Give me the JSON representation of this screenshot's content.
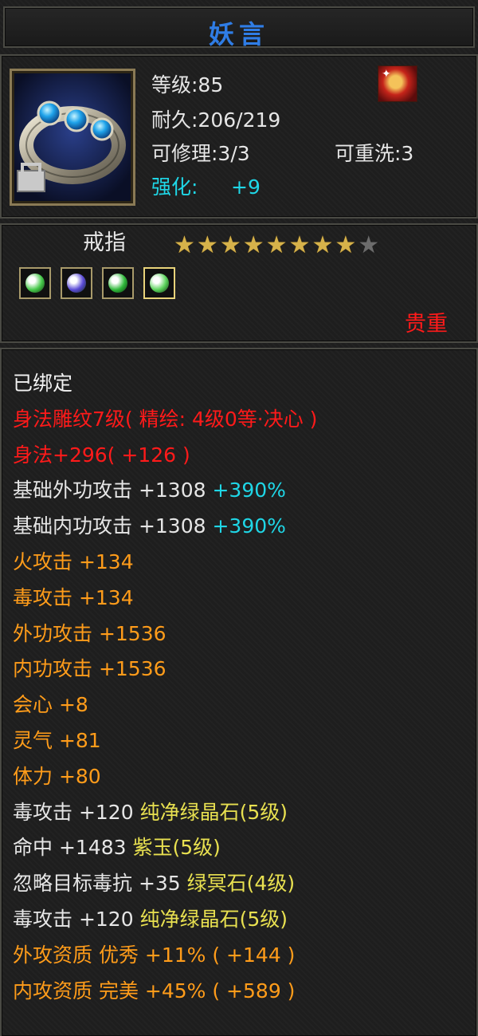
{
  "item": {
    "name": "妖言",
    "level": "等级:85",
    "durability": "耐久:206/219",
    "repair": "可修理:3/3",
    "rewash": "可重洗:3",
    "enhance_label": "强化:",
    "enhance_value": "+9",
    "type": "戒指",
    "rarity": "贵重",
    "stars_filled": 8,
    "stars_total": 9
  },
  "gems": [
    {
      "icon": "green-gem-icon",
      "color": "#46c84a"
    },
    {
      "icon": "purple-gem-icon",
      "color": "#5a4ad6"
    },
    {
      "icon": "green-crystal-icon",
      "color": "#2fb83a"
    },
    {
      "icon": "green-gem-icon",
      "color": "#5ad25a"
    }
  ],
  "stats": [
    {
      "parts": [
        {
          "t": "已绑定",
          "c": "white"
        }
      ]
    },
    {
      "parts": [
        {
          "t": "身法雕纹7级( 精绘: 4级0等·决心 )",
          "c": "red"
        }
      ]
    },
    {
      "parts": [
        {
          "t": "身法+296( +126 )",
          "c": "red"
        }
      ]
    },
    {
      "parts": [
        {
          "t": "基础外功攻击 +1308 ",
          "c": "gray"
        },
        {
          "t": "+390%",
          "c": "cyan"
        }
      ]
    },
    {
      "parts": [
        {
          "t": "基础内功攻击 +1308 ",
          "c": "gray"
        },
        {
          "t": "+390%",
          "c": "cyan"
        }
      ]
    },
    {
      "parts": [
        {
          "t": "火攻击 +134",
          "c": "orange"
        }
      ]
    },
    {
      "parts": [
        {
          "t": "毒攻击 +134",
          "c": "orange"
        }
      ]
    },
    {
      "parts": [
        {
          "t": "外功攻击 +1536",
          "c": "orange"
        }
      ]
    },
    {
      "parts": [
        {
          "t": "内功攻击 +1536",
          "c": "orange"
        }
      ]
    },
    {
      "parts": [
        {
          "t": "会心 +8",
          "c": "orange"
        }
      ]
    },
    {
      "parts": [
        {
          "t": "灵气 +81",
          "c": "orange"
        }
      ]
    },
    {
      "parts": [
        {
          "t": "体力 +80",
          "c": "orange"
        }
      ]
    },
    {
      "parts": [
        {
          "t": "毒攻击 +120 ",
          "c": "gray"
        },
        {
          "t": "纯净绿晶石(5级)",
          "c": "yellow"
        }
      ]
    },
    {
      "parts": [
        {
          "t": "命中 +1483 ",
          "c": "gray"
        },
        {
          "t": "紫玉(5级)",
          "c": "yellow"
        }
      ]
    },
    {
      "parts": [
        {
          "t": "忽略目标毒抗 +35 ",
          "c": "gray"
        },
        {
          "t": "绿冥石(4级)",
          "c": "yellow"
        }
      ]
    },
    {
      "parts": [
        {
          "t": "毒攻击 +120 ",
          "c": "gray"
        },
        {
          "t": "纯净绿晶石(5级)",
          "c": "yellow"
        }
      ]
    },
    {
      "parts": [
        {
          "t": "外攻资质  优秀 +11% ( +144 )",
          "c": "orange"
        }
      ]
    },
    {
      "parts": [
        {
          "t": "内攻资质  完美 +45% ( +589 )",
          "c": "orange"
        }
      ]
    }
  ],
  "colors": {
    "title": "#2f7de6",
    "cyan": "#1fd6e6",
    "red": "#ff1a1a",
    "orange": "#ff9c1a",
    "yellow": "#e8e050",
    "border": "#4a4a44"
  }
}
